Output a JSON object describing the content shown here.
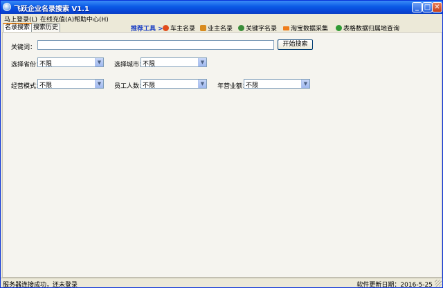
{
  "window": {
    "title": "飞跃企业名录搜索 V1.1",
    "controls": [
      "_",
      "□",
      "✕"
    ]
  },
  "menu": [
    "马上登录(L)",
    "在线充值(A)",
    "帮助中心(H)"
  ],
  "tabs": [
    {
      "label": "名录搜索",
      "active": true
    },
    {
      "label": "搜索历史",
      "active": false
    }
  ],
  "recommend_label": "推荐工具 >>",
  "tools": [
    {
      "label": "车主名录",
      "icon": "car-owner-icon",
      "color": "#e14b1c"
    },
    {
      "label": "业主名录",
      "icon": "homeowner-icon",
      "color": "#d88b1e"
    },
    {
      "label": "关键字名录",
      "icon": "keyword-icon",
      "color": "#3a8e3a"
    },
    {
      "label": "淘宝数据采集",
      "icon": "taobao-icon",
      "color": "#ef7d1a"
    },
    {
      "label": "表格数据归属地查询",
      "icon": "table-lookup-icon",
      "color": "#2f9a33"
    }
  ],
  "search": {
    "keyword_label": "关键词：",
    "keyword_value": "",
    "start_button": "开始搜索"
  },
  "filters": {
    "province_label": "选择省份：",
    "province_value": "不限",
    "city_label": "选择城市：",
    "city_value": "不限",
    "mode_label": "经营模式：",
    "mode_value": "不限",
    "staff_label": "员工人数：",
    "staff_value": "不限",
    "revenue_label": "年营业额：",
    "revenue_value": "不限"
  },
  "status": {
    "left": "服务器连接成功，还未登录",
    "right": "软件更新日期：2016-5-25"
  }
}
